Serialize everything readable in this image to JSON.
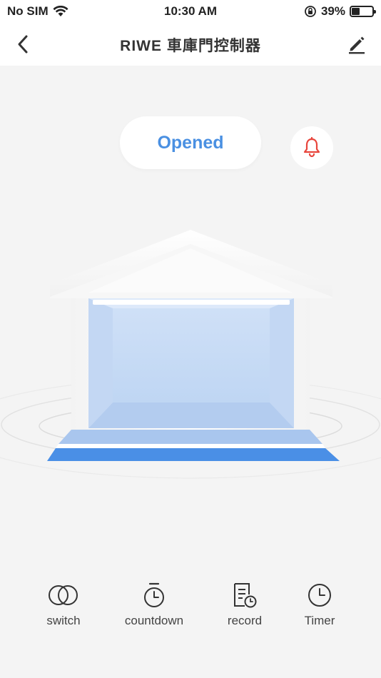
{
  "status_bar": {
    "carrier": "No SIM",
    "time": "10:30 AM",
    "battery_percent_label": "39%",
    "battery_level": 0.39
  },
  "nav": {
    "title": "RIWE 車庫門控制器",
    "back_icon": "chevron-left-icon",
    "edit_icon": "pencil-icon"
  },
  "door": {
    "status": "Opened",
    "alert_icon": "bell-icon"
  },
  "toolbar": {
    "items": [
      {
        "label": "switch",
        "icon": "toggle-circles-icon"
      },
      {
        "label": "countdown",
        "icon": "stopwatch-icon"
      },
      {
        "label": "record",
        "icon": "document-clock-icon"
      },
      {
        "label": "Timer",
        "icon": "clock-icon"
      }
    ]
  },
  "colors": {
    "accent": "#4a90e2",
    "bell": "#e8453c",
    "background": "#f4f4f4"
  }
}
